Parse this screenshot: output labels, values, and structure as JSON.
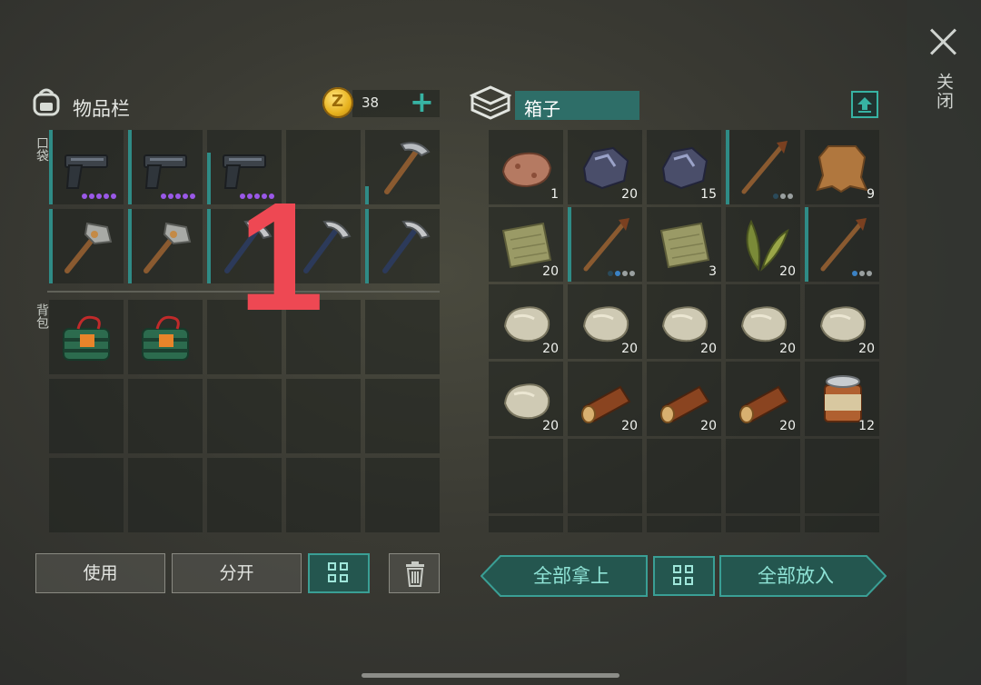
{
  "close": {
    "label": "关闭"
  },
  "inventory": {
    "title": "物品栏",
    "coins": "38",
    "pocket_label": "口袋",
    "backpack_label": "背包",
    "overlay_number": "1",
    "pocket": [
      {
        "icon": "pistol",
        "bar": 1.0,
        "dots": [
          "#9a58e8",
          "#9a58e8",
          "#9a58e8",
          "#9a58e8",
          "#9a58e8"
        ]
      },
      {
        "icon": "pistol",
        "bar": 1.0,
        "dots": [
          "#9a58e8",
          "#9a58e8",
          "#9a58e8",
          "#9a58e8",
          "#9a58e8"
        ]
      },
      {
        "icon": "pistol",
        "bar": 0.7,
        "dots": [
          "#9a58e8",
          "#9a58e8",
          "#9a58e8",
          "#9a58e8",
          "#9a58e8"
        ]
      },
      {
        "icon": "empty"
      },
      {
        "icon": "pickaxe",
        "bar": 0.25
      },
      {
        "icon": "hammer-stone",
        "bar": 1.0
      },
      {
        "icon": "hammer-stone",
        "bar": 1.0
      },
      {
        "icon": "pickaxe-iron",
        "bar": 1.0
      },
      {
        "icon": "pickaxe-iron",
        "bar": 1.0
      },
      {
        "icon": "pickaxe-iron",
        "bar": 1.0
      }
    ],
    "backpack": [
      {
        "icon": "bomb"
      },
      {
        "icon": "bomb"
      },
      {
        "icon": "empty"
      },
      {
        "icon": "empty"
      },
      {
        "icon": "empty"
      },
      {
        "icon": "empty"
      },
      {
        "icon": "empty"
      },
      {
        "icon": "empty"
      },
      {
        "icon": "empty"
      },
      {
        "icon": "empty"
      },
      {
        "icon": "empty"
      },
      {
        "icon": "empty"
      },
      {
        "icon": "empty"
      },
      {
        "icon": "empty"
      },
      {
        "icon": "empty"
      }
    ],
    "buttons": {
      "use": "使用",
      "split": "分开"
    }
  },
  "chest": {
    "title": "箱子",
    "slots": [
      {
        "icon": "copper-ore",
        "count": "1"
      },
      {
        "icon": "iron-ore",
        "count": "20"
      },
      {
        "icon": "iron-ore",
        "count": "15"
      },
      {
        "icon": "spear",
        "bar": 1.0,
        "dots": [
          "#2a4a5a",
          "#9aa0a0",
          "#9aa0a0"
        ]
      },
      {
        "icon": "hide",
        "count": "9"
      },
      {
        "icon": "cloth",
        "count": "20"
      },
      {
        "icon": "spear",
        "bar": 1.0,
        "dots": [
          "#2a4a5a",
          "#3b82c4",
          "#9aa0a0",
          "#9aa0a0"
        ]
      },
      {
        "icon": "cloth",
        "count": "3"
      },
      {
        "icon": "leaves",
        "count": "20"
      },
      {
        "icon": "spear",
        "bar": 1.0,
        "dots": [
          "#3b82c4",
          "#9aa0a0",
          "#9aa0a0"
        ]
      },
      {
        "icon": "stone",
        "count": "20"
      },
      {
        "icon": "stone",
        "count": "20"
      },
      {
        "icon": "stone",
        "count": "20"
      },
      {
        "icon": "stone",
        "count": "20"
      },
      {
        "icon": "stone",
        "count": "20"
      },
      {
        "icon": "stone",
        "count": "20"
      },
      {
        "icon": "log",
        "count": "20"
      },
      {
        "icon": "log",
        "count": "20"
      },
      {
        "icon": "log",
        "count": "20"
      },
      {
        "icon": "can",
        "count": "12"
      },
      {
        "icon": "empty"
      },
      {
        "icon": "empty"
      },
      {
        "icon": "empty"
      },
      {
        "icon": "empty"
      },
      {
        "icon": "empty"
      }
    ],
    "buttons": {
      "take_all": "全部拿上",
      "put_all": "全部放入"
    }
  },
  "colors": {
    "accent": "#37b3a3",
    "durability": "#2f8b86",
    "overlay": "#ee4853"
  }
}
